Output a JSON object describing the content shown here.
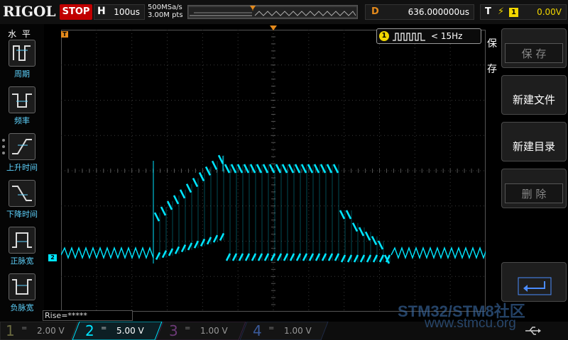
{
  "topbar": {
    "logo": "RIGOL",
    "run_state": "STOP",
    "horizontal_label": "H",
    "timebase": "100us",
    "sample_rate": "500MSa/s",
    "memory_depth": "3.00M pts",
    "delay_label": "D",
    "delay_value": "636.000000us",
    "trigger_label": "T",
    "trigger_edge_icon": "rising-edge-icon",
    "trigger_source": "1",
    "trigger_level": "0.00V"
  },
  "left_menu": {
    "title": "水 平",
    "items": [
      {
        "label": "周期",
        "icon": "period-icon"
      },
      {
        "label": "频率",
        "icon": "frequency-icon"
      },
      {
        "label": "上升时间",
        "icon": "rise-time-icon"
      },
      {
        "label": "下降时间",
        "icon": "fall-time-icon"
      },
      {
        "label": "正脉宽",
        "icon": "positive-width-icon"
      },
      {
        "label": "负脉宽",
        "icon": "negative-width-icon"
      }
    ]
  },
  "measurement": "Rise=*****",
  "trigger_freq": {
    "channel": "1",
    "value": "< 15Hz"
  },
  "right_menu": {
    "title_top": "保",
    "title_bottom": "存",
    "buttons": [
      {
        "label": "保 存",
        "enabled": false
      },
      {
        "label": "新建文件",
        "enabled": true
      },
      {
        "label": "新建目录",
        "enabled": true
      },
      {
        "label": "删 除",
        "enabled": false
      },
      {
        "label": "",
        "icon": "return-icon",
        "enabled": true
      }
    ]
  },
  "channels": [
    {
      "num": "1",
      "coupling": "=",
      "scale": "2.00 V",
      "color": "#f2d700",
      "active": false
    },
    {
      "num": "2",
      "coupling": "=",
      "scale": "5.00 V",
      "color": "#00e5ff",
      "active": true
    },
    {
      "num": "3",
      "coupling": "=",
      "scale": "1.00 V",
      "color": "#e040fb",
      "active": false
    },
    {
      "num": "4",
      "coupling": "=",
      "scale": "1.00 V",
      "color": "#4b8cff",
      "active": false
    }
  ],
  "markers": {
    "trigger_pos": "T",
    "ch2": "2",
    "trigger_level": "T"
  },
  "colors": {
    "ch2_trace": "#00e5ff",
    "trigger_marker": "#e48a1c",
    "grid": "#3a3a3a"
  },
  "watermark": {
    "line1": "STM32/STM8社区",
    "line2": "www.stmcu.org"
  }
}
